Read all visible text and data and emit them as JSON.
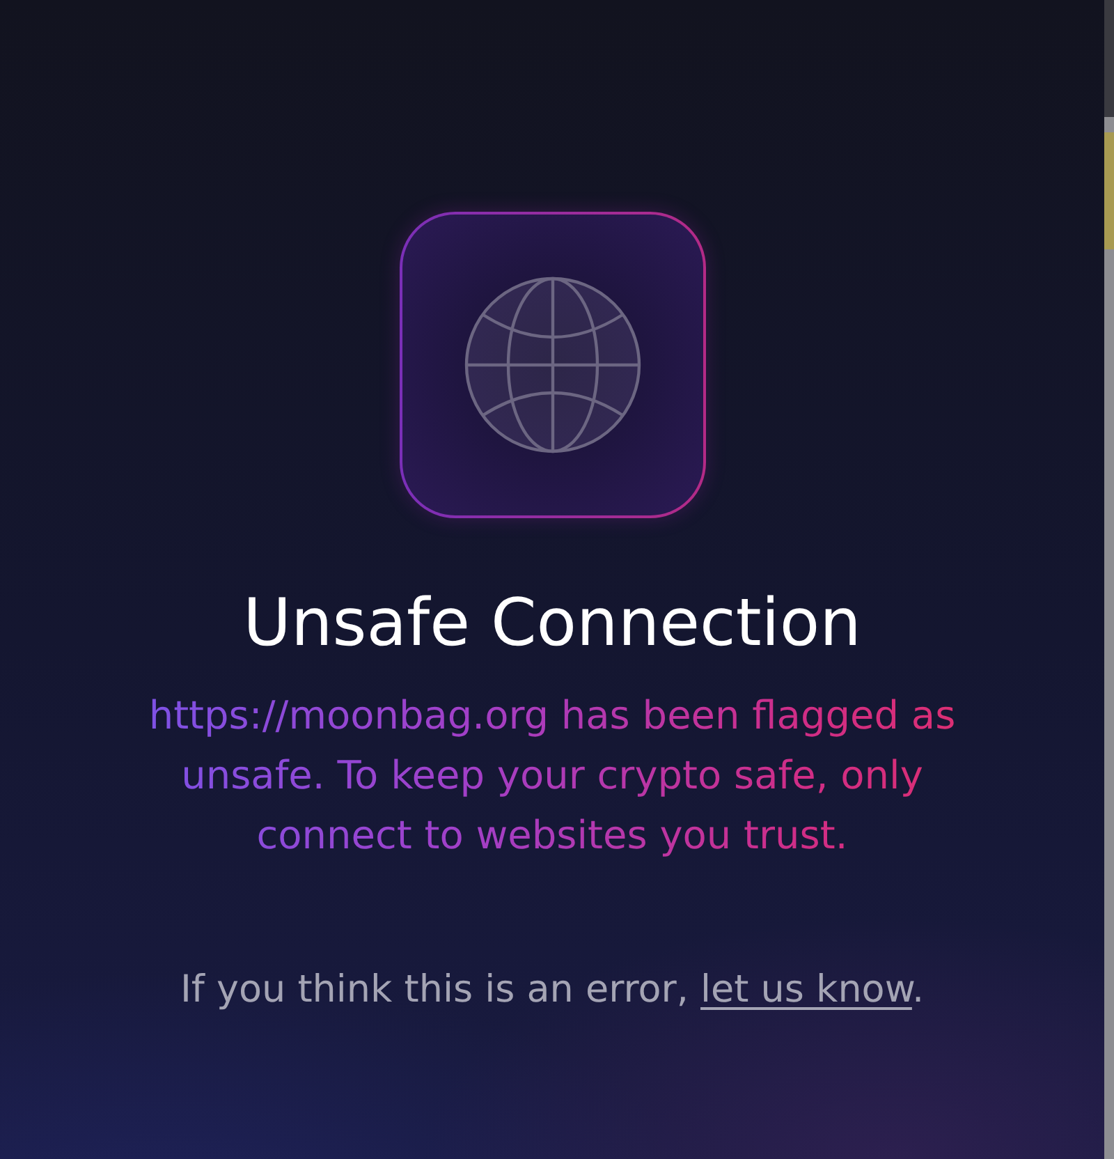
{
  "title": "Unsafe Connection",
  "message": "https://moonbag.org has been flagged as unsafe. To keep your crypto safe, only connect to websites you trust.",
  "footer": {
    "text": "If you think this is an error, ",
    "link": "let us know",
    "suffix": "."
  }
}
